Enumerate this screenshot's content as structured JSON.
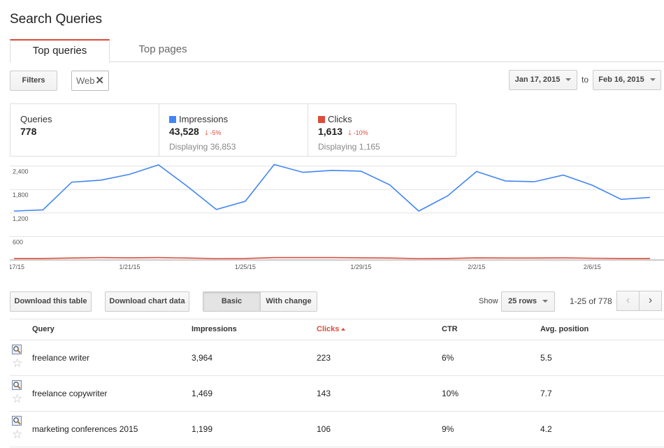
{
  "page": {
    "title": "Search Queries"
  },
  "tabs": [
    {
      "label": "Top queries",
      "active": true
    },
    {
      "label": "Top pages",
      "active": false
    }
  ],
  "filters": {
    "filters_label": "Filters",
    "chip_label": "Web",
    "chip_remove": "✕",
    "date_from": "Jan 17, 2015",
    "to_label": "to",
    "date_to": "Feb 16, 2015"
  },
  "metrics": {
    "queries": {
      "label": "Queries",
      "value": "778"
    },
    "impressions": {
      "label": "Impressions",
      "value": "43,528",
      "change": "-5%",
      "displaying": "Displaying 36,853",
      "color": "#4285f4"
    },
    "clicks": {
      "label": "Clicks",
      "value": "1,613",
      "change": "-10%",
      "displaying": "Displaying 1,165",
      "color": "#dd4b39"
    }
  },
  "chart_data": {
    "type": "line",
    "x": [
      "1/17/15",
      "1/18/15",
      "1/19/15",
      "1/20/15",
      "1/21/15",
      "1/22/15",
      "1/23/15",
      "1/24/15",
      "1/25/15",
      "1/26/15",
      "1/27/15",
      "1/28/15",
      "1/29/15",
      "1/30/15",
      "1/31/15",
      "2/1/15",
      "2/2/15",
      "2/3/15",
      "2/4/15",
      "2/5/15",
      "2/6/15",
      "2/7/15",
      "2/8/15"
    ],
    "xticks": [
      "1/17/15",
      "1/21/15",
      "1/25/15",
      "1/29/15",
      "2/2/15",
      "2/6/15"
    ],
    "yticks": [
      "2,400",
      "1,800",
      "1,200",
      "600"
    ],
    "ylim": [
      0,
      2500
    ],
    "series": [
      {
        "name": "Impressions",
        "color": "#4285f4",
        "values": [
          1250,
          1280,
          1990,
          2040,
          2190,
          2430,
          1880,
          1290,
          1500,
          2440,
          2240,
          2290,
          2270,
          1920,
          1250,
          1640,
          2260,
          2020,
          2000,
          2170,
          1910,
          1550,
          1600
        ]
      },
      {
        "name": "Clicks",
        "color": "#dd4b39",
        "values": [
          40,
          40,
          50,
          60,
          55,
          60,
          50,
          35,
          40,
          60,
          60,
          60,
          55,
          50,
          35,
          40,
          55,
          50,
          50,
          55,
          45,
          40,
          40
        ]
      }
    ],
    "grid": true
  },
  "toolbar": {
    "download_table": "Download this table",
    "download_chart": "Download chart data",
    "basic": "Basic",
    "with_change": "With change",
    "show_label": "Show",
    "rows_select": "25 rows",
    "range": "1-25 of 778",
    "prev": "‹",
    "next": "›"
  },
  "table": {
    "columns": [
      "Query",
      "Impressions",
      "Clicks",
      "CTR",
      "Avg. position"
    ],
    "rows": [
      {
        "query": "freelance writer",
        "impressions": "3,964",
        "clicks": "223",
        "ctr": "6%",
        "position": "5.5"
      },
      {
        "query": "freelance copywriter",
        "impressions": "1,469",
        "clicks": "143",
        "ctr": "10%",
        "position": "7.7"
      },
      {
        "query": "marketing conferences 2015",
        "impressions": "1,199",
        "clicks": "106",
        "ctr": "9%",
        "position": "4.2"
      }
    ],
    "row_icon": "magnifier-page-icon",
    "star_glyph": "☆"
  }
}
